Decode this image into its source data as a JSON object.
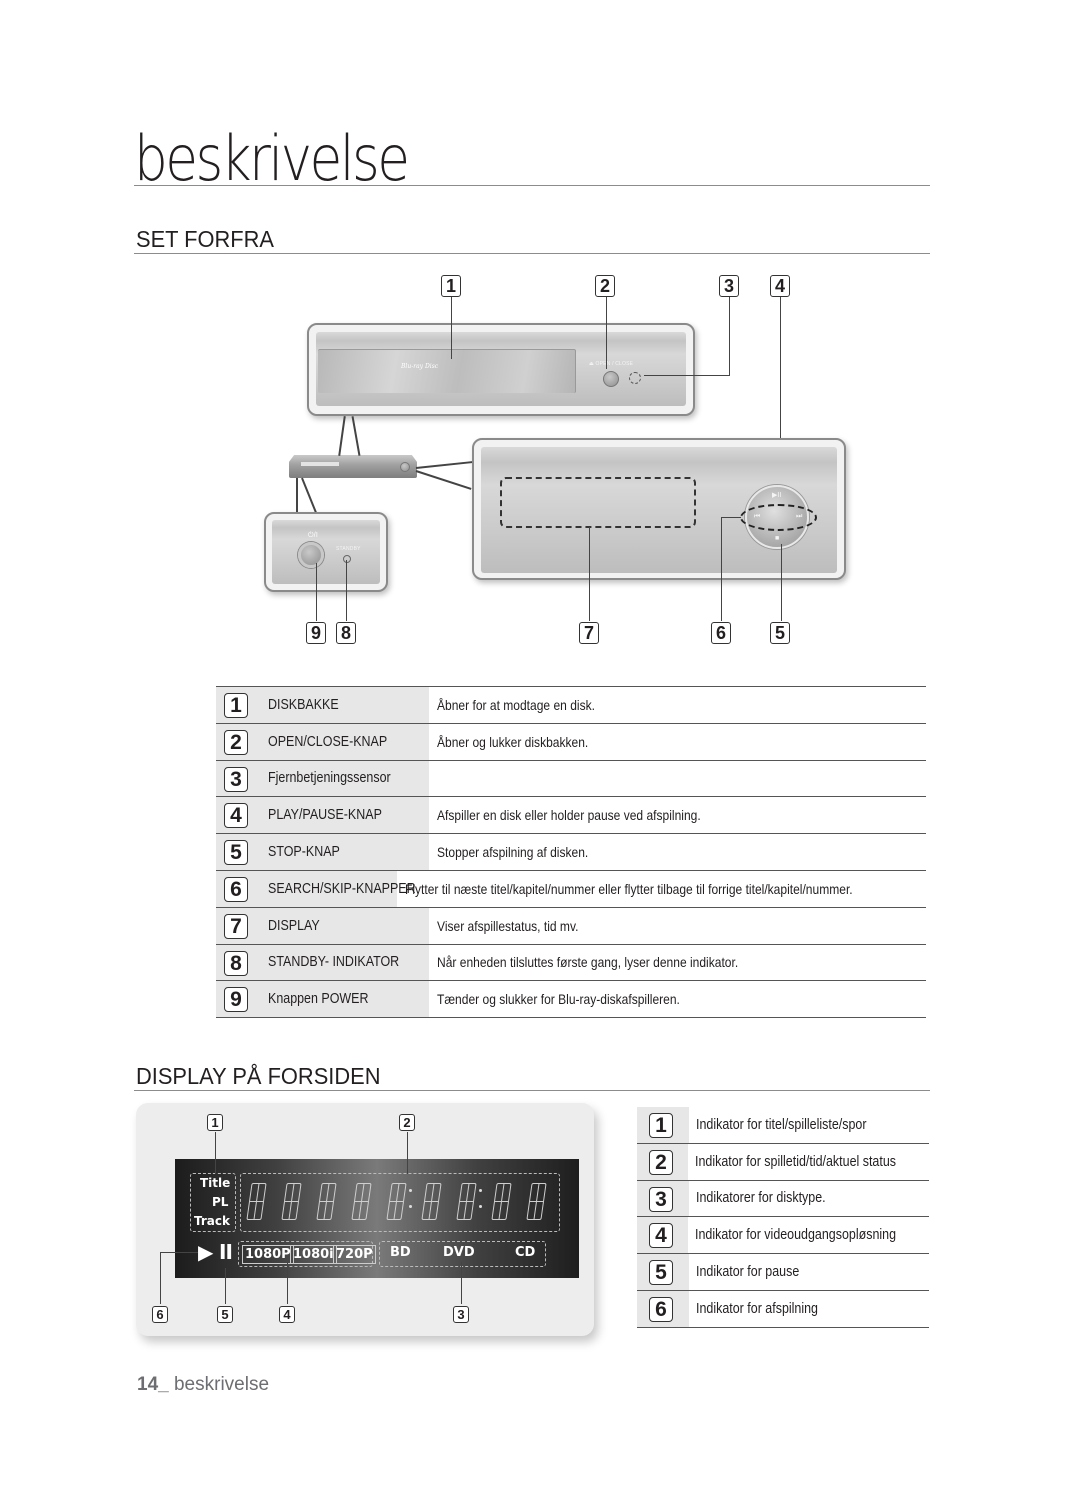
{
  "page": {
    "title": "beskrivelse",
    "footer_number": "14_",
    "footer_label": "beskrivelse"
  },
  "section_front": {
    "heading": "SET FORFRA",
    "diagram": {
      "callouts_top": [
        "1",
        "2",
        "3",
        "4"
      ],
      "callouts_bottom": [
        "9",
        "8",
        "7",
        "6",
        "5"
      ],
      "labels": {
        "bluray_logo": "Blu-ray Disc",
        "open_close": "⏏ OPEN / CLOSE",
        "power_symbol": "⏻/I",
        "standby": "STANDBY",
        "play_pause_glyph": "▶II",
        "prev_glyph": "⏮",
        "next_glyph": "⏭",
        "stop_glyph": "■"
      }
    },
    "rows": [
      {
        "num": "1",
        "name": "DISKBAKKE",
        "desc": "Åbner for at modtage en disk."
      },
      {
        "num": "2",
        "name": "OPEN/CLOSE-KNAP",
        "desc": "Åbner og lukker diskbakken."
      },
      {
        "num": "3",
        "name": "Fjernbetjeningssensor",
        "desc": ""
      },
      {
        "num": "4",
        "name": "PLAY/PAUSE-KNAP",
        "desc": "Afspiller en disk eller holder pause ved afspilning."
      },
      {
        "num": "5",
        "name": "STOP-KNAP",
        "desc": "Stopper afspilning af disken."
      },
      {
        "num": "6",
        "name": "SEARCH/SKIP-KNAPPER",
        "desc": "Flytter til næste titel/kapitel/nummer eller flytter tilbage til forrige titel/kapitel/nummer."
      },
      {
        "num": "7",
        "name": "DISPLAY",
        "desc": "Viser afspillestatus, tid mv."
      },
      {
        "num": "8",
        "name": "STANDBY- INDIKATOR",
        "desc": "Når enheden tilsluttes første gang, lyser denne indikator."
      },
      {
        "num": "9",
        "name": "Knappen POWER",
        "desc": "Tænder og slukker for Blu-ray-diskafspilleren."
      }
    ]
  },
  "section_display": {
    "heading": "DISPLAY PÅ FORSIDEN",
    "diagram": {
      "callouts_top": [
        "1",
        "2"
      ],
      "callouts_bottom": [
        "6",
        "5",
        "4",
        "3"
      ],
      "mode_labels": [
        "Title",
        "PL",
        "Track"
      ],
      "segment_digit_count": 9,
      "play_glyph": "▶",
      "pause_glyph": "II",
      "resolutions": [
        "1080P",
        "1080i",
        "720P"
      ],
      "disc_types": [
        "BD",
        "DVD",
        "CD"
      ]
    },
    "rows": [
      {
        "num": "1",
        "desc": "Indikator for titel/spilleliste/spor"
      },
      {
        "num": "2",
        "desc": "Indikator for spilletid/tid/aktuel status"
      },
      {
        "num": "3",
        "desc": "Indikatorer for disktype."
      },
      {
        "num": "4",
        "desc": "Indikator for videoudgangsopløsning"
      },
      {
        "num": "5",
        "desc": "Indikator for pause"
      },
      {
        "num": "6",
        "desc": "Indikator for afspilning"
      }
    ]
  }
}
